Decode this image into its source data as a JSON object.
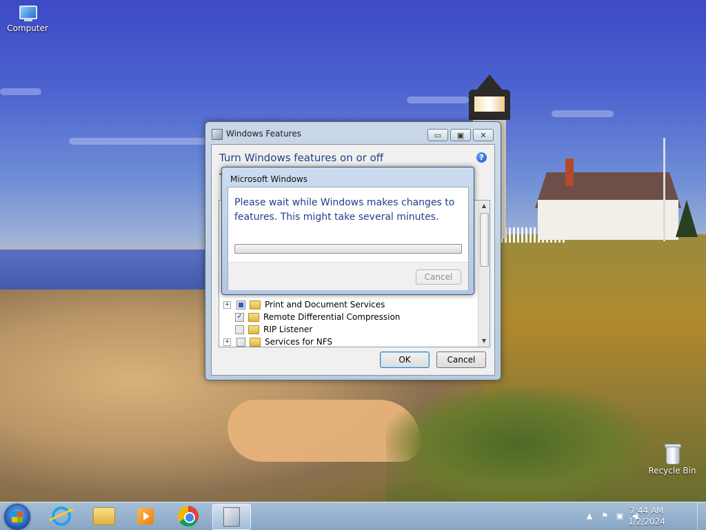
{
  "desktop": {
    "icons": [
      {
        "label": "Computer",
        "icon": "computer-icon"
      },
      {
        "label": "Recycle Bin",
        "icon": "recycle-bin-icon"
      }
    ]
  },
  "features_window": {
    "title": "Windows Features",
    "heading": "Turn Windows features on or off",
    "description_fragment": "T",
    "features": [
      {
        "label": "Print and Document Services",
        "state": "partial",
        "expandable": true
      },
      {
        "label": "Remote Differential Compression",
        "state": "checked",
        "expandable": false
      },
      {
        "label": "RIP Listener",
        "state": "unchecked",
        "expandable": false
      },
      {
        "label": "Services for NFS",
        "state": "unchecked",
        "expandable": true
      }
    ],
    "ok_label": "OK",
    "cancel_label": "Cancel"
  },
  "progress_dialog": {
    "title": "Microsoft Windows",
    "message": "Please wait while Windows makes changes to features. This might take several minutes.",
    "progress": 0,
    "cancel_label": "Cancel"
  },
  "taskbar": {
    "items": [
      "start-button",
      "internet-explorer",
      "windows-explorer",
      "windows-media-player",
      "google-chrome",
      "windows-features"
    ],
    "active_item": "windows-features",
    "clock": {
      "time": "7:44 AM",
      "date": "1/2/2024"
    }
  },
  "colors": {
    "heading_blue": "#1e3f8a",
    "progress_green": "#2aa12a"
  }
}
